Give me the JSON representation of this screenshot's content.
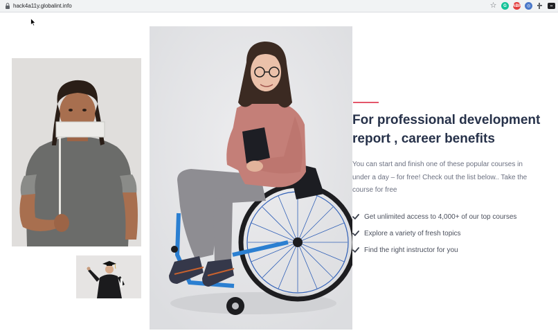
{
  "browser": {
    "url": "hack4a11y.globalint.info",
    "toolbar_icons": [
      "star-icon",
      "grammarly-extension-icon",
      "adblock-extension-icon",
      "blue-extension-icon",
      "puzzle-extension-icon",
      "camera-extension-icon"
    ],
    "extension_labels": {
      "adblock": "ABP"
    }
  },
  "images": [
    {
      "name": "man-holding-sign-photo",
      "alt": "man holding blank sign over mouth"
    },
    {
      "name": "graduate-photo",
      "alt": "graduate in cap and gown"
    },
    {
      "name": "woman-wheelchair-photo",
      "alt": "woman in wheelchair holding a book"
    }
  ],
  "content": {
    "heading": "For professional development report , career benefits",
    "description": "You can start and finish one of these popular courses in under a day – for free! Check out the list below.. Take the course for free",
    "benefits": [
      "Get unlimited access to 4,000+ of our top courses",
      "Explore a variety of fresh topics",
      "Find the right instructor for you"
    ]
  },
  "colors": {
    "accent": "#e4566b",
    "heading": "#27324a",
    "body_text": "#6b7080"
  }
}
